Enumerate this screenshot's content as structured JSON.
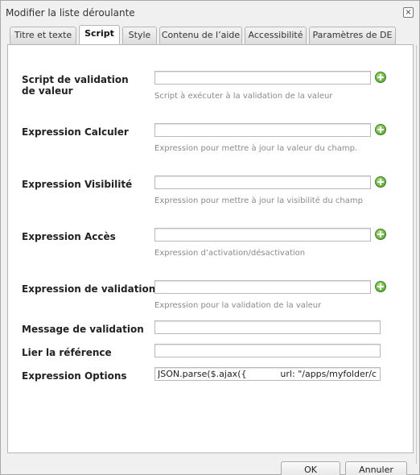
{
  "dialog": {
    "title": "Modifier la liste déroulante",
    "close_glyph": "×"
  },
  "tabs": [
    {
      "label": "Titre et texte"
    },
    {
      "label": "Script"
    },
    {
      "label": "Style"
    },
    {
      "label": "Contenu de l’aide"
    },
    {
      "label": "Accessibilité"
    },
    {
      "label": "Paramètres de DE"
    }
  ],
  "active_tab": "Script",
  "form": {
    "rows": [
      {
        "label": "Script de validation de valeur",
        "value": "",
        "hint": "Script à exécuter à la validation de la valeur",
        "icon": "add-icon"
      },
      {
        "label": "Expression Calculer",
        "value": "",
        "hint": "Expression pour mettre à jour la valeur du champ.",
        "icon": "add-icon"
      },
      {
        "label": "Expression Visibilité",
        "value": "",
        "hint": "Expression pour mettre à jour la visibilité du champ",
        "icon": "add-icon"
      },
      {
        "label": "Expression Accès",
        "value": "",
        "hint": "Expression d’activation/désactivation",
        "icon": "add-icon"
      },
      {
        "label": "Expression de validation",
        "value": "",
        "hint": "Expression pour la validation de la valeur",
        "icon": "add-icon"
      },
      {
        "label": "Message de validation",
        "value": ""
      },
      {
        "label": "Lier la référence",
        "value": ""
      },
      {
        "label": "Expression Options",
        "value": "JSON.parse($.ajax({            url: \"/apps/myfolder/c"
      }
    ]
  },
  "buttons": {
    "ok": "OK",
    "cancel": "Annuler"
  },
  "colors": {
    "add_icon": "#4a9a2a",
    "hint_text": "#8a8a8a"
  }
}
